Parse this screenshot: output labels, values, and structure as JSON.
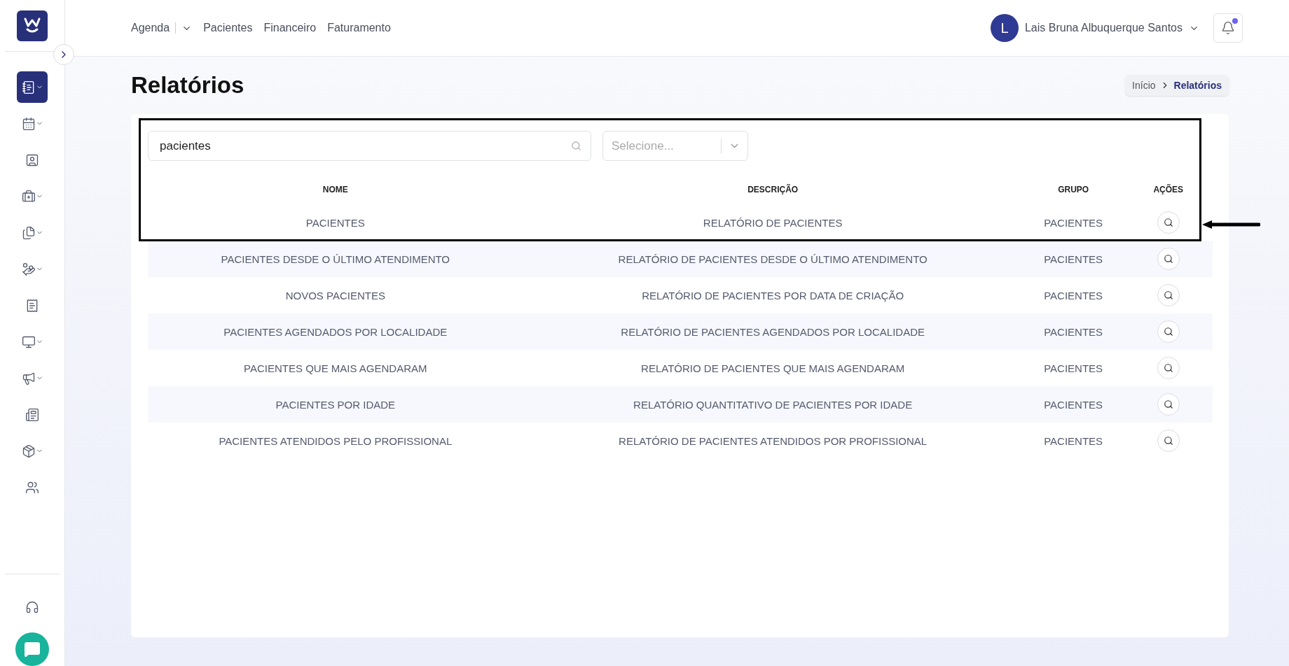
{
  "sidebar": {
    "items": [
      {
        "selected": true,
        "expandable": true
      },
      {
        "selected": false,
        "expandable": true
      },
      {
        "selected": false,
        "expandable": false
      },
      {
        "selected": false,
        "expandable": true
      },
      {
        "selected": false,
        "expandable": true
      },
      {
        "selected": false,
        "expandable": true
      },
      {
        "selected": false,
        "expandable": false
      },
      {
        "selected": false,
        "expandable": true
      },
      {
        "selected": false,
        "expandable": true
      },
      {
        "selected": false,
        "expandable": false
      },
      {
        "selected": false,
        "expandable": true
      },
      {
        "selected": false,
        "expandable": false
      }
    ]
  },
  "topnav": {
    "items": [
      {
        "label": "Agenda",
        "dropdown": true
      },
      {
        "label": "Pacientes",
        "dropdown": false
      },
      {
        "label": "Financeiro",
        "dropdown": false
      },
      {
        "label": "Faturamento",
        "dropdown": false
      }
    ],
    "user": {
      "initial": "L",
      "name": "Lais Bruna Albuquerque Santos"
    },
    "notification": true
  },
  "page": {
    "title": "Relatórios",
    "breadcrumb": [
      {
        "label": "Início",
        "selected": false
      },
      {
        "label": "Relatórios",
        "selected": true
      }
    ]
  },
  "filters": {
    "search": {
      "value": "pacientes"
    },
    "group_select": {
      "placeholder": "Selecione..."
    }
  },
  "table": {
    "columns": [
      "NOME",
      "DESCRIÇÃO",
      "GRUPO",
      "AÇÕES"
    ],
    "rows": [
      {
        "name": "PACIENTES",
        "description": "RELATÓRIO DE PACIENTES",
        "group": "PACIENTES"
      },
      {
        "name": "PACIENTES DESDE O ÚLTIMO ATENDIMENTO",
        "description": "RELATÓRIO DE PACIENTES DESDE O ÚLTIMO ATENDIMENTO",
        "group": "PACIENTES"
      },
      {
        "name": "NOVOS PACIENTES",
        "description": "RELATÓRIO DE PACIENTES POR DATA DE CRIAÇÃO",
        "group": "PACIENTES"
      },
      {
        "name": "PACIENTES AGENDADOS POR LOCALIDADE",
        "description": "RELATÓRIO DE PACIENTES AGENDADOS POR LOCALIDADE",
        "group": "PACIENTES"
      },
      {
        "name": "PACIENTES QUE MAIS AGENDARAM",
        "description": "RELATÓRIO DE PACIENTES QUE MAIS AGENDARAM",
        "group": "PACIENTES"
      },
      {
        "name": "PACIENTES POR IDADE",
        "description": "RELATÓRIO QUANTITATIVO DE PACIENTES POR IDADE",
        "group": "PACIENTES"
      },
      {
        "name": "PACIENTES ATENDIDOS PELO PROFISSIONAL",
        "description": "RELATÓRIO DE PACIENTES ATENDIDOS POR PROFISSIONAL",
        "group": "PACIENTES"
      }
    ]
  },
  "annotation": {
    "highlight": true
  }
}
